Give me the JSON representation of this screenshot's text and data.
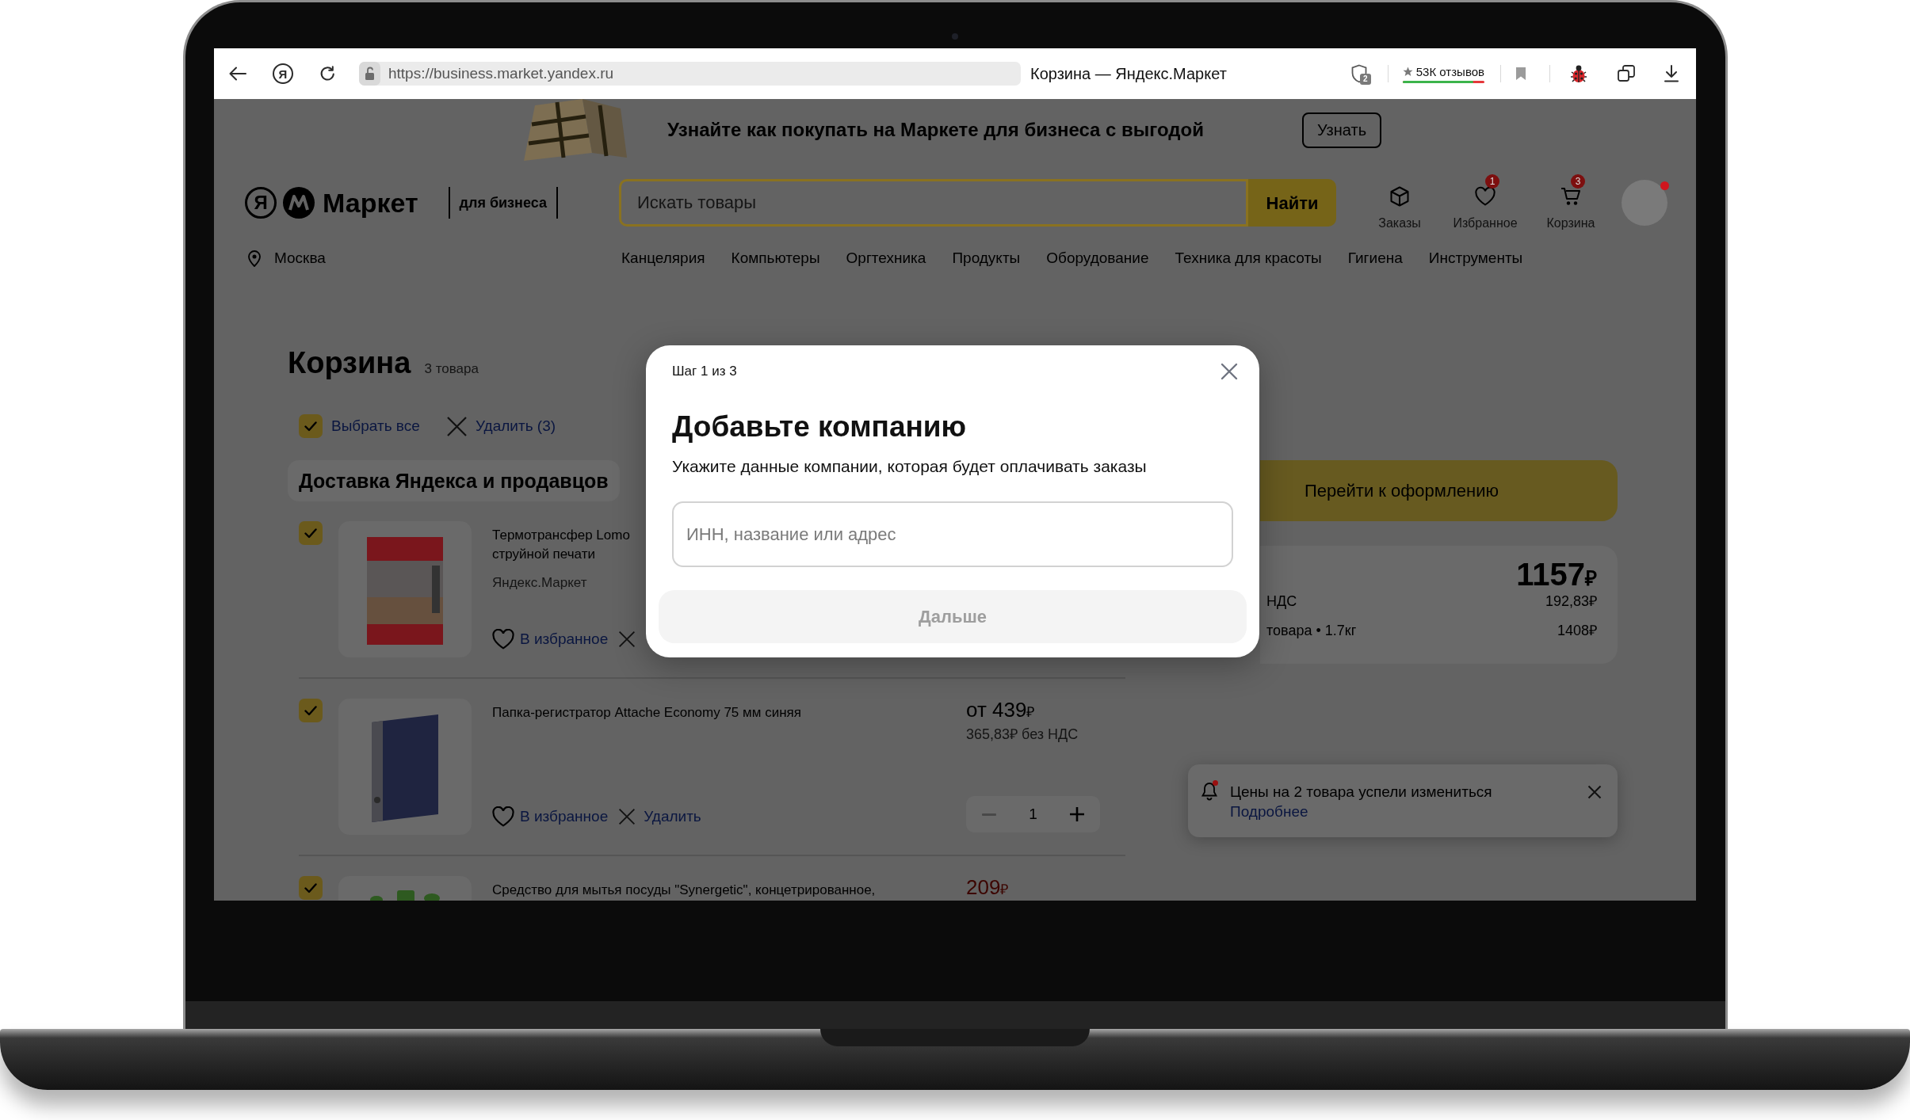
{
  "browser": {
    "home_glyph": "Я",
    "url": "https://business.market.yandex.ru",
    "tab_title": "Корзина — Яндекс.Маркет",
    "shield_badge": "2",
    "reviews": {
      "label": "53К отзывов",
      "level": 0.86
    }
  },
  "promo": {
    "text": "Узнайте как покупать на Маркете для бизнеса с выгодой",
    "button": "Узнать"
  },
  "header": {
    "logo_glyph": "Я",
    "logo_text": "Маркет",
    "logo_suffix": "для бизнеса",
    "search": {
      "placeholder": "Искать товары",
      "button": "Найти"
    },
    "actions": [
      {
        "kind": "orders",
        "label": "Заказы"
      },
      {
        "kind": "favorites",
        "label": "Избранное",
        "badge": "1"
      },
      {
        "kind": "cart",
        "label": "Корзина",
        "badge": "3"
      }
    ],
    "avatar": {
      "notification": true
    },
    "location": "Москва",
    "categories": [
      "Канцелярия",
      "Компьютеры",
      "Оргтехника",
      "Продукты",
      "Оборудование",
      "Техника для красоты",
      "Гигиена",
      "Инструменты"
    ]
  },
  "cart": {
    "title": "Корзина",
    "count": "3 товара",
    "select_all": {
      "label": "Выбрать все",
      "checked": true
    },
    "delete_all": "Удалить (3)",
    "section": "Доставка Яндекса и продавцов",
    "items": [
      {
        "kind": "package",
        "checked": true,
        "title": "Термотрансфер Lomo\nструйной печати",
        "seller": "Яндекс.Маркет",
        "favorite": "В избранное"
      },
      {
        "kind": "binder",
        "checked": true,
        "title": "Папка-регистратор Attache Economy 75 мм синяя",
        "price": {
          "amount": "от 439",
          "currency": "₽",
          "discounted": false
        },
        "price_note": "365,83₽ без НДС",
        "favorite": "В избранное",
        "delete": "Удалить",
        "quantity": {
          "value": "1",
          "decrement_disabled": true
        }
      },
      {
        "kind": "bottle",
        "checked": true,
        "title": "Средство для мытья посуды \"Synergetic\", концетрированное,",
        "price": {
          "amount": "209",
          "currency": "₽",
          "discounted": true
        }
      }
    ]
  },
  "summary": {
    "checkout": "Перейти к оформлению",
    "total": {
      "amount": "1157",
      "currency": "₽"
    },
    "rows": [
      {
        "label": "НДС",
        "value": "192,83₽"
      },
      {
        "label": "товара • 1.7кг",
        "value": "1408₽"
      }
    ]
  },
  "toast": {
    "text": "Цены на 2 товара успели измениться",
    "link": "Подробнее",
    "unread": true
  },
  "modal": {
    "step": "Шаг 1 из 3",
    "title": "Добавьте компанию",
    "subtitle": "Укажите данные компании, которая будет оплачивать заказы",
    "field": {
      "placeholder": "ИНН, название или адрес"
    },
    "button": {
      "label": "Дальше",
      "disabled": true
    }
  }
}
